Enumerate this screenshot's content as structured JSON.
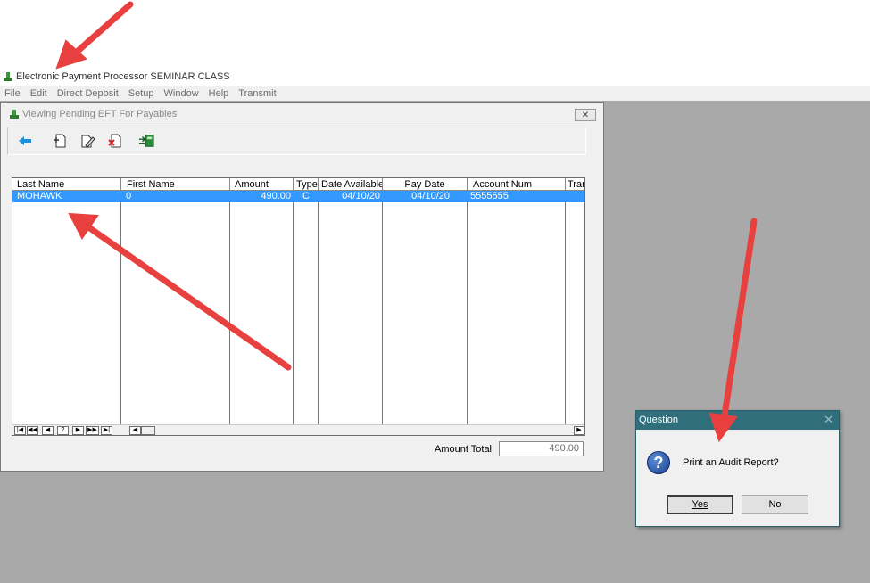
{
  "app": {
    "title": "Electronic Payment Processor  SEMINAR CLASS"
  },
  "menubar": [
    "File",
    "Edit",
    "Direct Deposit",
    "Setup",
    "Window",
    "Help",
    "Transmit"
  ],
  "child_window": {
    "title": "Viewing Pending EFT For Payables",
    "close": "✕",
    "toolbar_icons": [
      "back-arrow-icon",
      "add-document-icon",
      "edit-document-icon",
      "delete-document-icon",
      "transmit-icon"
    ]
  },
  "grid": {
    "columns": [
      "Last Name",
      "First Name",
      "Amount",
      "Type",
      "Date Available",
      "Pay Date",
      "Account Num",
      "Tran"
    ],
    "rows": [
      {
        "last_name": "MOHAWK",
        "first_name": "0",
        "amount": "490.00",
        "type": "C",
        "date_available": "04/10/20",
        "pay_date": "04/10/20",
        "account_num": "5555555",
        "tran": ""
      }
    ],
    "nav_buttons": [
      "|◀",
      "◀◀",
      "◀",
      "?",
      "▶",
      "▶▶",
      "▶|"
    ]
  },
  "totals": {
    "label": "Amount Total",
    "value": "490.00"
  },
  "dialog": {
    "title": "Question",
    "message": "Print an Audit Report?",
    "yes_label": "Yes",
    "no_label": "No",
    "close": "✕"
  },
  "colors": {
    "selection": "#3399ff",
    "dialog_title_bar": "#2f6e7a",
    "annotation_arrow": "#e8403f",
    "mdi_background": "#a9a9a9"
  }
}
